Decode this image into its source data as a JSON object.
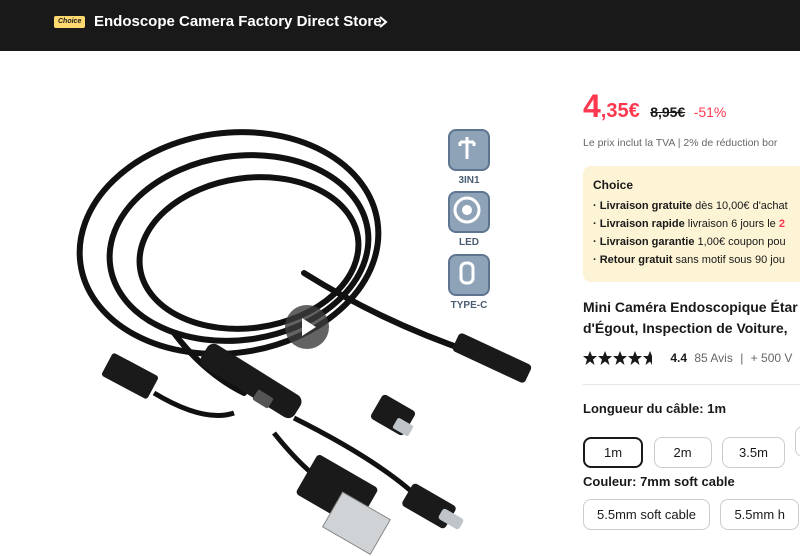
{
  "store": {
    "badge": "Choice",
    "name": "Endoscope Camera Factory Direct Store"
  },
  "features": [
    {
      "label": "3IN1",
      "icon": "pinout-icon"
    },
    {
      "label": "LED",
      "icon": "led-ring-icon"
    },
    {
      "label": "TYPE-C",
      "icon": "usb-c-icon"
    }
  ],
  "price": {
    "integer": "4",
    "decimal": ",35€",
    "original": "8,95€",
    "discount": "-51%",
    "tva_note": "Le prix inclut la TVA | 2% de réduction bor"
  },
  "choice_box": {
    "title": "Choice",
    "lines": [
      {
        "bold": "· Livraison gratuite",
        "text": " dès 10,00€ d'achat",
        "red": ""
      },
      {
        "bold": "· Livraison rapide",
        "text": "  livraison 6 jours le ",
        "red": "2"
      },
      {
        "bold": "· Livraison garantie",
        "text": "  1,00€ coupon pou",
        "red": ""
      },
      {
        "bold": "· Retour gratuit",
        "text": "  sans motif sous 90 jou",
        "red": ""
      }
    ]
  },
  "product": {
    "title_line1": "Mini Caméra Endoscopique Étar",
    "title_line2": "d'Égout, Inspection de Voiture,"
  },
  "rating": {
    "score": 4.4,
    "score_text": "4.4",
    "reviews": "85 Avis",
    "divider": "|",
    "sold": "+ 500 V"
  },
  "cable_length": {
    "label": "Longueur du câble:",
    "selected": "1m",
    "options": [
      "1m",
      "2m",
      "3.5m",
      ""
    ]
  },
  "color": {
    "label": "Couleur:",
    "selected": "7mm soft cable",
    "options": [
      "5.5mm soft cable",
      "5.5mm h"
    ]
  },
  "colors": {
    "accent": "#fd384f",
    "topbar": "#191919",
    "choice_badge": "#fdd96f",
    "choice_box_bg": "#fdf3d5"
  }
}
